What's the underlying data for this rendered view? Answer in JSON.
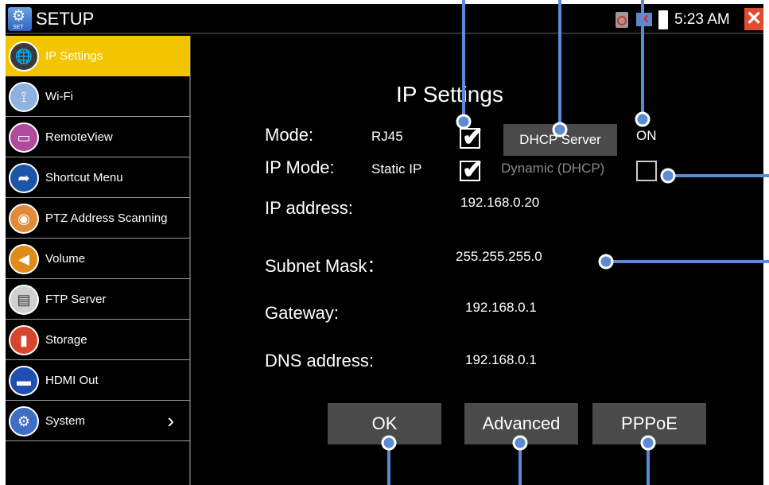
{
  "titlebar": {
    "app_name": "SETUP",
    "app_icon_caption": "SET",
    "clock": "5:23 AM"
  },
  "sidebar": {
    "items": [
      {
        "label": "IP Settings",
        "icon": "globe-icon",
        "active": true
      },
      {
        "label": "Wi-Fi",
        "icon": "wifi-antenna-icon"
      },
      {
        "label": "RemoteView",
        "icon": "remote-view-icon"
      },
      {
        "label": "Shortcut Menu",
        "icon": "shortcut-icon"
      },
      {
        "label": "PTZ Address Scanning",
        "icon": "ptz-camera-icon"
      },
      {
        "label": "Volume",
        "icon": "speaker-icon"
      },
      {
        "label": "FTP Server",
        "icon": "ftp-server-icon"
      },
      {
        "label": "Storage",
        "icon": "storage-card-icon"
      },
      {
        "label": "HDMI Out",
        "icon": "hdmi-icon"
      },
      {
        "label": "System",
        "icon": "system-icon",
        "has_arrow": true
      }
    ]
  },
  "content": {
    "title": "IP Settings",
    "mode": {
      "label": "Mode:",
      "value": "RJ45",
      "checked": true,
      "dhcp_server_button": "DHCP Server",
      "dhcp_state": "ON"
    },
    "ip_mode": {
      "label": "IP Mode:",
      "static_label": "Static IP",
      "static_checked": true,
      "dynamic_label": "Dynamic (DHCP)",
      "dynamic_checked": false
    },
    "ip_address": {
      "label": "IP address:",
      "value": "192.168.0.20"
    },
    "subnet_mask": {
      "label": "Subnet Mask：",
      "value": "255.255.255.0"
    },
    "gateway": {
      "label": "Gateway:",
      "value": "192.168.0.1"
    },
    "dns": {
      "label": "DNS address:",
      "value": "192.168.0.1"
    },
    "buttons": {
      "ok": "OK",
      "advanced": "Advanced",
      "pppoe": "PPPoE"
    }
  },
  "colors": {
    "active_item": "#f2c500",
    "button_bg": "#4a4a4a",
    "callout": "#5b8bd4",
    "close_button": "#e24b2f"
  }
}
